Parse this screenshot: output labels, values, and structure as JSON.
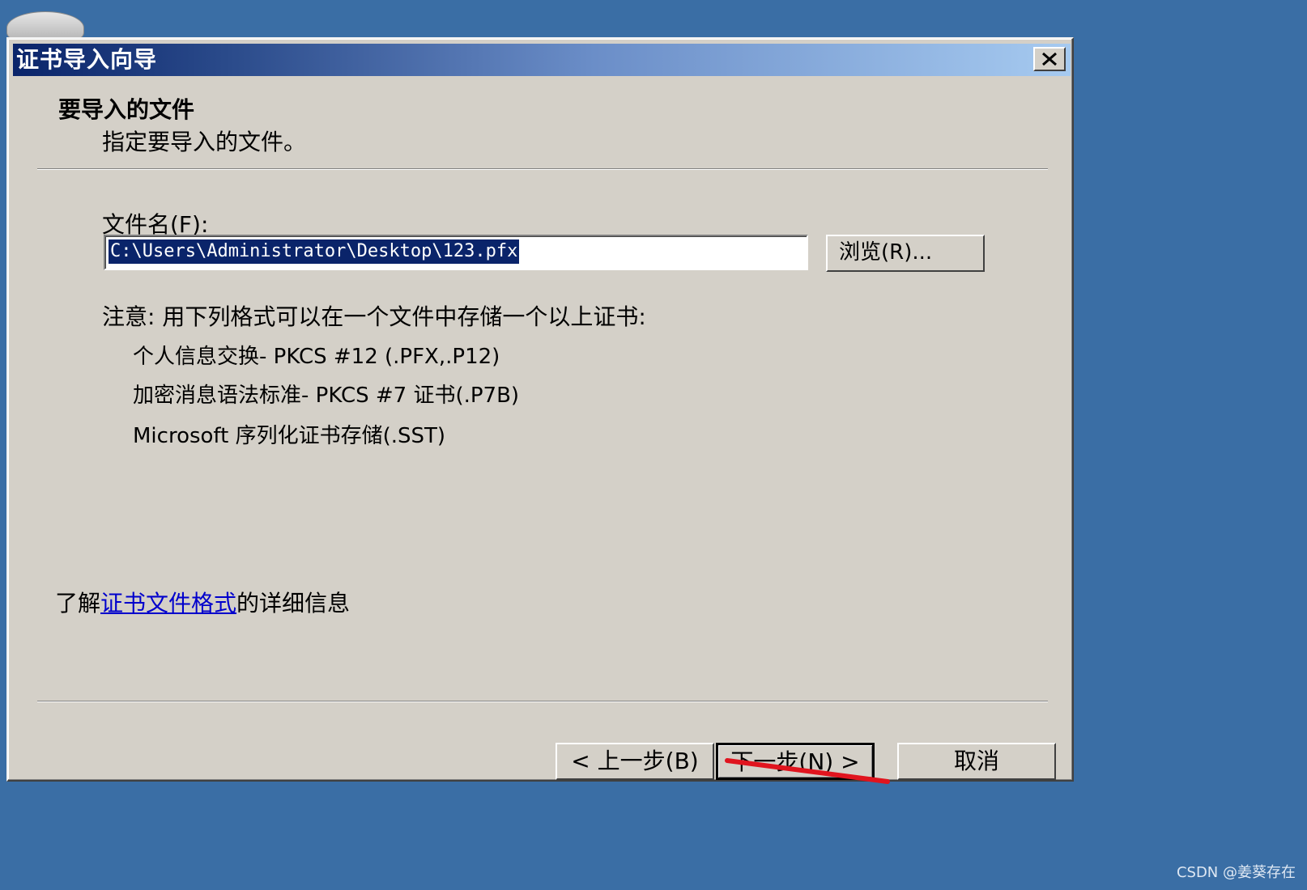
{
  "window": {
    "title": "证书导入向导"
  },
  "header": {
    "section_title": "要导入的文件",
    "section_subtitle": "指定要导入的文件。"
  },
  "file": {
    "label": "文件名(F):",
    "value": "C:\\Users\\Administrator\\Desktop\\123.pfx",
    "browse_label": "浏览(R)..."
  },
  "notes": {
    "intro": "注意: 用下列格式可以在一个文件中存储一个以上证书:",
    "formats": [
      "个人信息交换- PKCS #12 (.PFX,.P12)",
      "加密消息语法标准- PKCS #7 证书(.P7B)",
      "Microsoft 序列化证书存储(.SST)"
    ]
  },
  "info": {
    "prefix": "了解",
    "link": "证书文件格式",
    "suffix": "的详细信息"
  },
  "buttons": {
    "back": "< 上一步(B)",
    "next": "下一步(N) >",
    "cancel": "取消"
  },
  "watermark": "CSDN @姜葵存在",
  "colors": {
    "desktop": "#3a6ea5",
    "dialog": "#d4d0c8",
    "selection": "#0a246a",
    "link": "#0000cc",
    "annotation": "#e0141e"
  }
}
